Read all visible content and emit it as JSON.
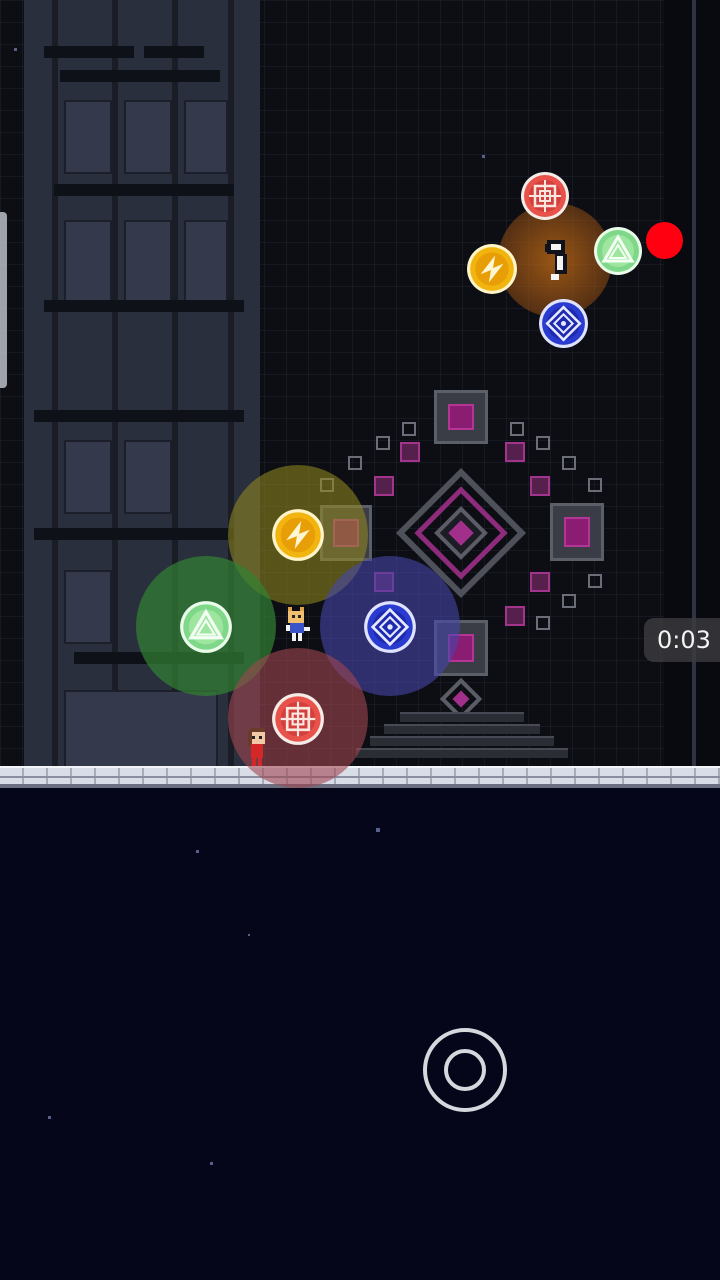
{
  "hud": {
    "timer": "0:03"
  },
  "colors": {
    "red_orb": "#e8524a",
    "yellow_orb": "#f2b40e",
    "green_orb": "#7fd88a",
    "blue_orb": "#2a3bcf",
    "record": "#ff0010",
    "altar_accent": "#a2308b"
  },
  "orbs": {
    "boss_ring": [
      {
        "kind": "red",
        "icon": "crosshair-icon"
      },
      {
        "kind": "yellow",
        "icon": "bolt-icon"
      },
      {
        "kind": "green",
        "icon": "triangle-icon"
      },
      {
        "kind": "blue",
        "icon": "diamond-icon"
      }
    ],
    "player_ring": [
      {
        "kind": "yellow",
        "icon": "bolt-icon"
      },
      {
        "kind": "green",
        "icon": "triangle-icon"
      },
      {
        "kind": "blue",
        "icon": "diamond-icon"
      },
      {
        "kind": "red",
        "icon": "crosshair-icon"
      }
    ]
  },
  "controls": {
    "joystick": "joystick-icon",
    "record_indicator": "record-icon"
  }
}
